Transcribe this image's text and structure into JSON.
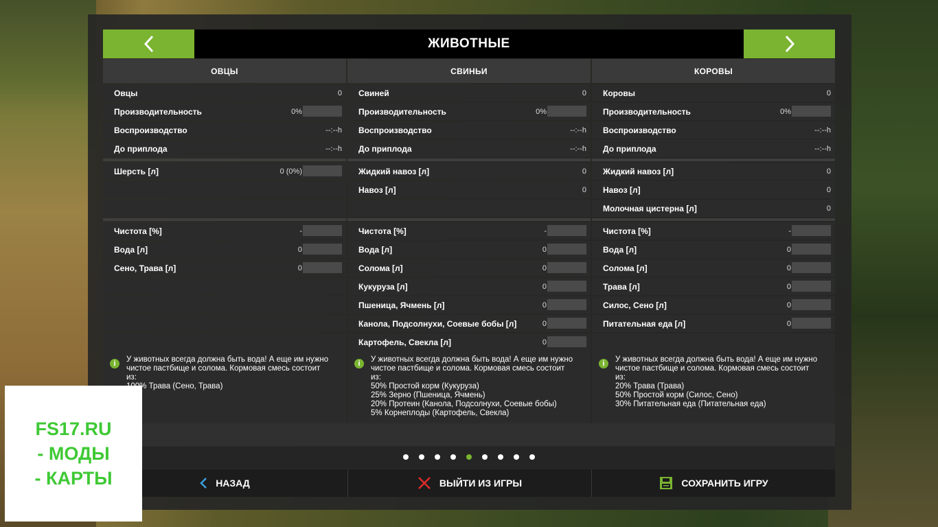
{
  "header": {
    "title": "ЖИВОТНЫЕ"
  },
  "columns": [
    {
      "heading": "ОВЦЫ",
      "stats": [
        {
          "label": "Овцы",
          "value": "0"
        },
        {
          "label": "Производительность",
          "value": "0%"
        },
        {
          "label": "Воспроизводство",
          "value": "--:--h"
        },
        {
          "label": "До приплода",
          "value": "--:--h"
        }
      ],
      "products": [
        {
          "label": "Шерсть [л]",
          "value": "0 (0%)"
        }
      ],
      "needs": [
        {
          "label": "Чистота [%]",
          "value": "-"
        },
        {
          "label": "Вода [л]",
          "value": "0"
        },
        {
          "label": "Сено, Трава [л]",
          "value": "0"
        }
      ],
      "info": [
        "У животных всегда должна быть вода! А еще им нужно",
        "чистое пастбище и солома. Кормовая смесь состоит",
        "из:",
        "100% Трава (Сено, Трава)"
      ]
    },
    {
      "heading": "СВИНЬИ",
      "stats": [
        {
          "label": "Свиней",
          "value": "0"
        },
        {
          "label": "Производительность",
          "value": "0%"
        },
        {
          "label": "Воспроизводство",
          "value": "--:--h"
        },
        {
          "label": "До приплода",
          "value": "--:--h"
        }
      ],
      "products": [
        {
          "label": "Жидкий навоз [л]",
          "value": "0"
        },
        {
          "label": "Навоз [л]",
          "value": "0"
        }
      ],
      "needs": [
        {
          "label": "Чистота [%]",
          "value": "-"
        },
        {
          "label": "Вода [л]",
          "value": "0"
        },
        {
          "label": "Солома [л]",
          "value": "0"
        },
        {
          "label": "Кукуруза [л]",
          "value": "0"
        },
        {
          "label": "Пшеница, Ячмень [л]",
          "value": "0"
        },
        {
          "label": "Канола, Подсолнухи, Соевые бобы [л]",
          "value": "0"
        },
        {
          "label": "Картофель, Свекла [л]",
          "value": "0"
        }
      ],
      "info": [
        "У животных всегда должна быть вода! А еще им нужно",
        "чистое пастбище и солома. Кормовая смесь состоит",
        "из:",
        "50% Простой корм (Кукуруза)",
        "25% Зерно (Пшеница, Ячмень)",
        "20% Протеин (Канола, Подсолнухи, Соевые бобы)",
        "5% Корнеплоды (Картофель, Свекла)"
      ]
    },
    {
      "heading": "КОРОВЫ",
      "stats": [
        {
          "label": "Коровы",
          "value": "0"
        },
        {
          "label": "Производительность",
          "value": "0%"
        },
        {
          "label": "Воспроизводство",
          "value": "--:--h"
        },
        {
          "label": "До приплода",
          "value": "--:--h"
        }
      ],
      "products": [
        {
          "label": "Жидкий навоз [л]",
          "value": "0"
        },
        {
          "label": "Навоз [л]",
          "value": "0"
        },
        {
          "label": "Молочная цистерна [л]",
          "value": "0"
        }
      ],
      "needs": [
        {
          "label": "Чистота [%]",
          "value": "-"
        },
        {
          "label": "Вода [л]",
          "value": "0"
        },
        {
          "label": "Солома [л]",
          "value": "0"
        },
        {
          "label": "Трава [л]",
          "value": "0"
        },
        {
          "label": "Силос, Сено [л]",
          "value": "0"
        },
        {
          "label": "Питательная еда [л]",
          "value": "0"
        }
      ],
      "info": [
        "У животных всегда должна быть вода! А еще им нужно",
        "чистое пастбище и солома. Кормовая смесь состоит",
        "из:",
        "20% Трава (Трава)",
        "50% Простой корм (Силос, Сено)",
        "30% Питательная еда (Питательная еда)"
      ]
    }
  ],
  "pagination": {
    "total": 9,
    "active_index": 4
  },
  "footer": {
    "back_label": "НАЗАД",
    "quit_label": "ВЫЙТИ ИЗ ИГРЫ",
    "save_label": "СОХРАНИТЬ ИГРУ"
  },
  "watermark": {
    "lines": [
      "FS17.RU",
      "- МОДЫ",
      "- КАРТЫ"
    ]
  },
  "colors": {
    "accent": "#7ab431",
    "panel": "#2b2b2b",
    "header": "#3a3a3a"
  }
}
